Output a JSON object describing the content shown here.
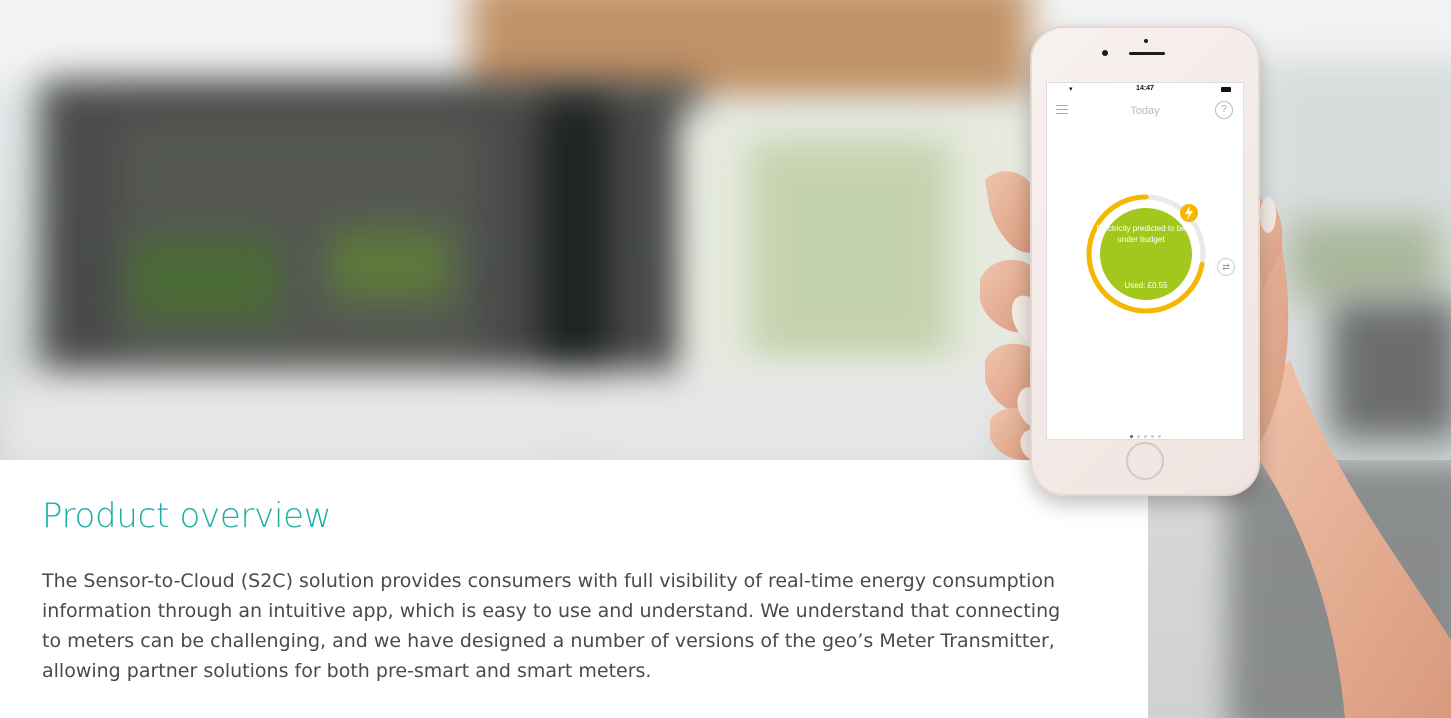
{
  "phone_app": {
    "status_time": "14:47",
    "screen_title": "Today",
    "help_glyph": "?",
    "gauge_message": "Electricity predicted to be under budget",
    "gauge_used": "Used: £0.55",
    "gauge_progress": 0.72,
    "gauge_color": "#f5b800",
    "gauge_fill": "#a2c81e",
    "page_dots": 5,
    "active_dot": 0,
    "icons": [
      "menu-icon",
      "help-icon",
      "lightning-icon",
      "refresh-icon"
    ]
  },
  "content": {
    "title": "Product overview",
    "body": "The Sensor-to-Cloud (S2C) solution provides consumers with full visibility of real-time energy consumption information through an intuitive app, which is easy to use and understand. We understand that connecting to meters can be challenging, and we have designed a number of versions of the geo’s Meter Transmitter, allowing partner solutions for both pre-smart and smart meters.",
    "title_color": "#1aaea5"
  }
}
